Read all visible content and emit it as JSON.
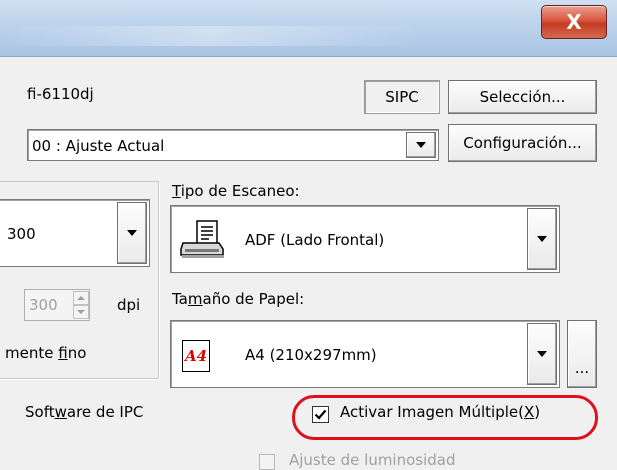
{
  "window": {
    "close_label": "X"
  },
  "device": {
    "name": "fi-6110dj",
    "sipc_label": "SIPC",
    "selection_button": "Selección..."
  },
  "profile": {
    "value": "00 : Ajuste Actual",
    "config_button": "Configuración..."
  },
  "resolution": {
    "value": "300",
    "custom_value": "300",
    "unit": "dpi",
    "quality_prefix": "mente ",
    "quality_underlined": "f",
    "quality_suffix": "ino"
  },
  "scan_type": {
    "label_underlined": "T",
    "label_rest": "ipo de Escaneo:",
    "value": "ADF (Lado Frontal)",
    "icon": "scanner-icon"
  },
  "paper_size": {
    "label_prefix": "Ta",
    "label_underlined": "m",
    "label_rest": "año de Papel:",
    "value": "A4 (210x297mm)",
    "badge": "A4",
    "more_button": "..."
  },
  "ipc": {
    "label_prefix": "Soft",
    "label_underlined": "w",
    "label_rest": "are de IPC"
  },
  "multi_image": {
    "label": "Activar Imagen Múltiple(",
    "label_key": "X",
    "label_close": ")",
    "checked": true,
    "highlight_color": "#e0101b"
  },
  "partial": {
    "label": "Ajuste de luminosidad"
  }
}
